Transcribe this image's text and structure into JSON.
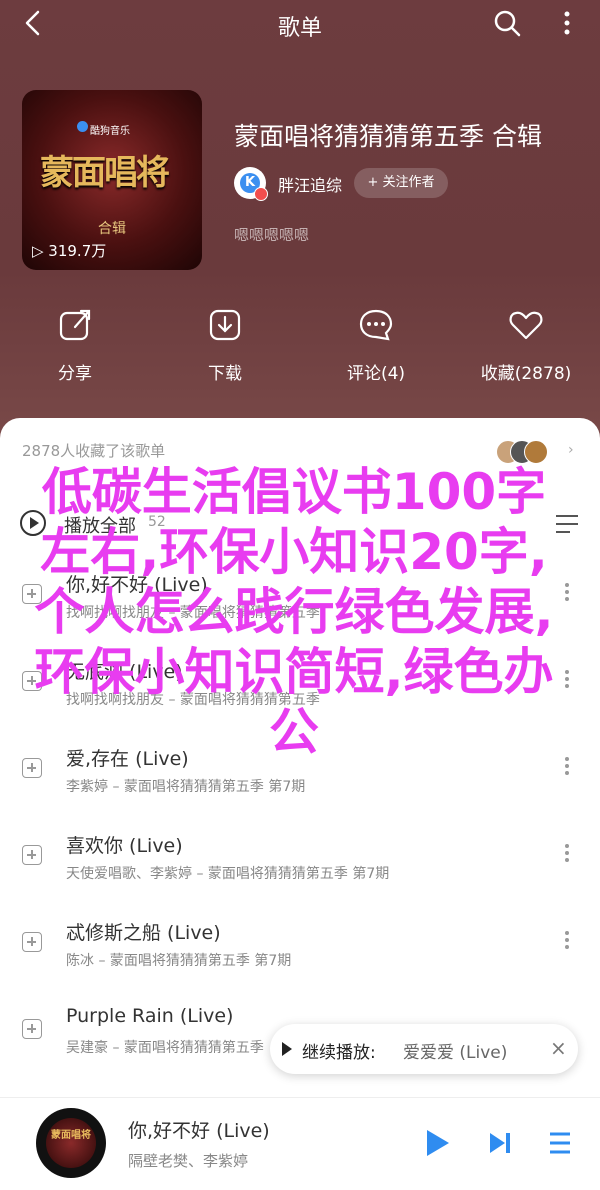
{
  "header": {
    "title": "歌单"
  },
  "album": {
    "cover_brand": "酷狗音乐",
    "cover_title": "蒙面唱将",
    "cover_subtitle": "合辑",
    "play_count": "▷ 319.7万",
    "title": "蒙面唱将猜猜猜第五季 合辑",
    "creator": "胖汪追综",
    "follow_label": "+ 关注作者",
    "description": "嗯嗯"
  },
  "actions": [
    {
      "icon": "share-icon",
      "label": "分享"
    },
    {
      "icon": "download-icon",
      "label": "下载"
    },
    {
      "icon": "comment-icon",
      "label": "评论(4)"
    },
    {
      "icon": "heart-icon",
      "label": "收藏(2878)"
    }
  ],
  "collectors_text": "2878人收藏了该歌单",
  "play_all": {
    "label": "播放全部",
    "count": "52"
  },
  "songs": [
    {
      "name": "你,好不好 (Live)",
      "meta": "找啊找啊找朋友 – 蒙面唱将猜猜猜第五季"
    },
    {
      "name": "无底洞 (Live)",
      "meta": "找啊找啊找朋友 – 蒙面唱将猜猜猜第五季"
    },
    {
      "name": "爱,存在 (Live)",
      "meta": "李紫婷 – 蒙面唱将猜猜猜第五季 第7期"
    },
    {
      "name": "喜欢你 (Live)",
      "meta": "天使爱唱歌、李紫婷 – 蒙面唱将猜猜猜第五季 第7期"
    },
    {
      "name": "忒修斯之船 (Live)",
      "meta": "陈冰 – 蒙面唱将猜猜猜第五季 第7期"
    },
    {
      "name": "Purple Rain (Live)",
      "meta": "吴建豪 – 蒙面唱将猜猜猜第五季"
    }
  ],
  "toast": {
    "label": "继续播放:",
    "song": "爱爱爱 (Live)"
  },
  "watermark": "低碳生活倡议书100字左右,环保小知识20字,个人怎么践行绿色发展,环保小知识简短,绿色办公",
  "player": {
    "song": "你,好不好 (Live)",
    "artist": "隔壁老樊、李紫婷",
    "disc_text": "蒙面唱将"
  },
  "colors": {
    "accent": "#2f8cf0",
    "header_bg": "#6b3c3d",
    "watermark": "#e83cf0"
  }
}
